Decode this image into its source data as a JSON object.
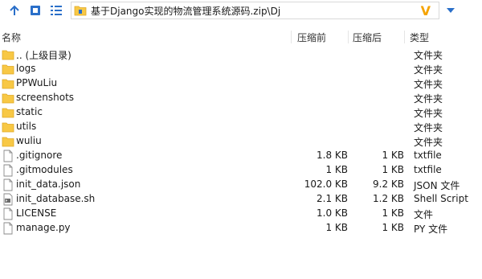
{
  "address": {
    "path": "基于Django实现的物流管理系统源码.zip\\Dj",
    "suffix_icon_letter": "V"
  },
  "columns": {
    "name": "名称",
    "size": "压缩前",
    "packed": "压缩后",
    "type": "类型"
  },
  "files": [
    {
      "name": ".. (上级目录)",
      "icon": "folder-icon",
      "size": "",
      "packed": "",
      "type": "文件夹"
    },
    {
      "name": "logs",
      "icon": "folder-icon",
      "size": "",
      "packed": "",
      "type": "文件夹"
    },
    {
      "name": "PPWuLiu",
      "icon": "folder-icon",
      "size": "",
      "packed": "",
      "type": "文件夹"
    },
    {
      "name": "screenshots",
      "icon": "folder-icon",
      "size": "",
      "packed": "",
      "type": "文件夹"
    },
    {
      "name": "static",
      "icon": "folder-icon",
      "size": "",
      "packed": "",
      "type": "文件夹"
    },
    {
      "name": "utils",
      "icon": "folder-icon",
      "size": "",
      "packed": "",
      "type": "文件夹"
    },
    {
      "name": "wuliu",
      "icon": "folder-icon",
      "size": "",
      "packed": "",
      "type": "文件夹"
    },
    {
      "name": ".gitignore",
      "icon": "file-icon",
      "size": "1.8 KB",
      "packed": "1 KB",
      "type": "txtfile"
    },
    {
      "name": ".gitmodules",
      "icon": "file-icon",
      "size": "1 KB",
      "packed": "1 KB",
      "type": "txtfile"
    },
    {
      "name": "init_data.json",
      "icon": "file-icon",
      "size": "102.0 KB",
      "packed": "9.2 KB",
      "type": "JSON 文件"
    },
    {
      "name": "init_database.sh",
      "icon": "script-icon",
      "size": "2.1 KB",
      "packed": "1.2 KB",
      "type": "Shell Script"
    },
    {
      "name": "LICENSE",
      "icon": "file-icon",
      "size": "1.0 KB",
      "packed": "1 KB",
      "type": "文件"
    },
    {
      "name": "manage.py",
      "icon": "file-icon",
      "size": "1 KB",
      "packed": "1 KB",
      "type": "PY 文件"
    }
  ],
  "colors": {
    "folder": "#f8c845",
    "folder_dark": "#e0a823",
    "accent": "#2a6fc9"
  }
}
